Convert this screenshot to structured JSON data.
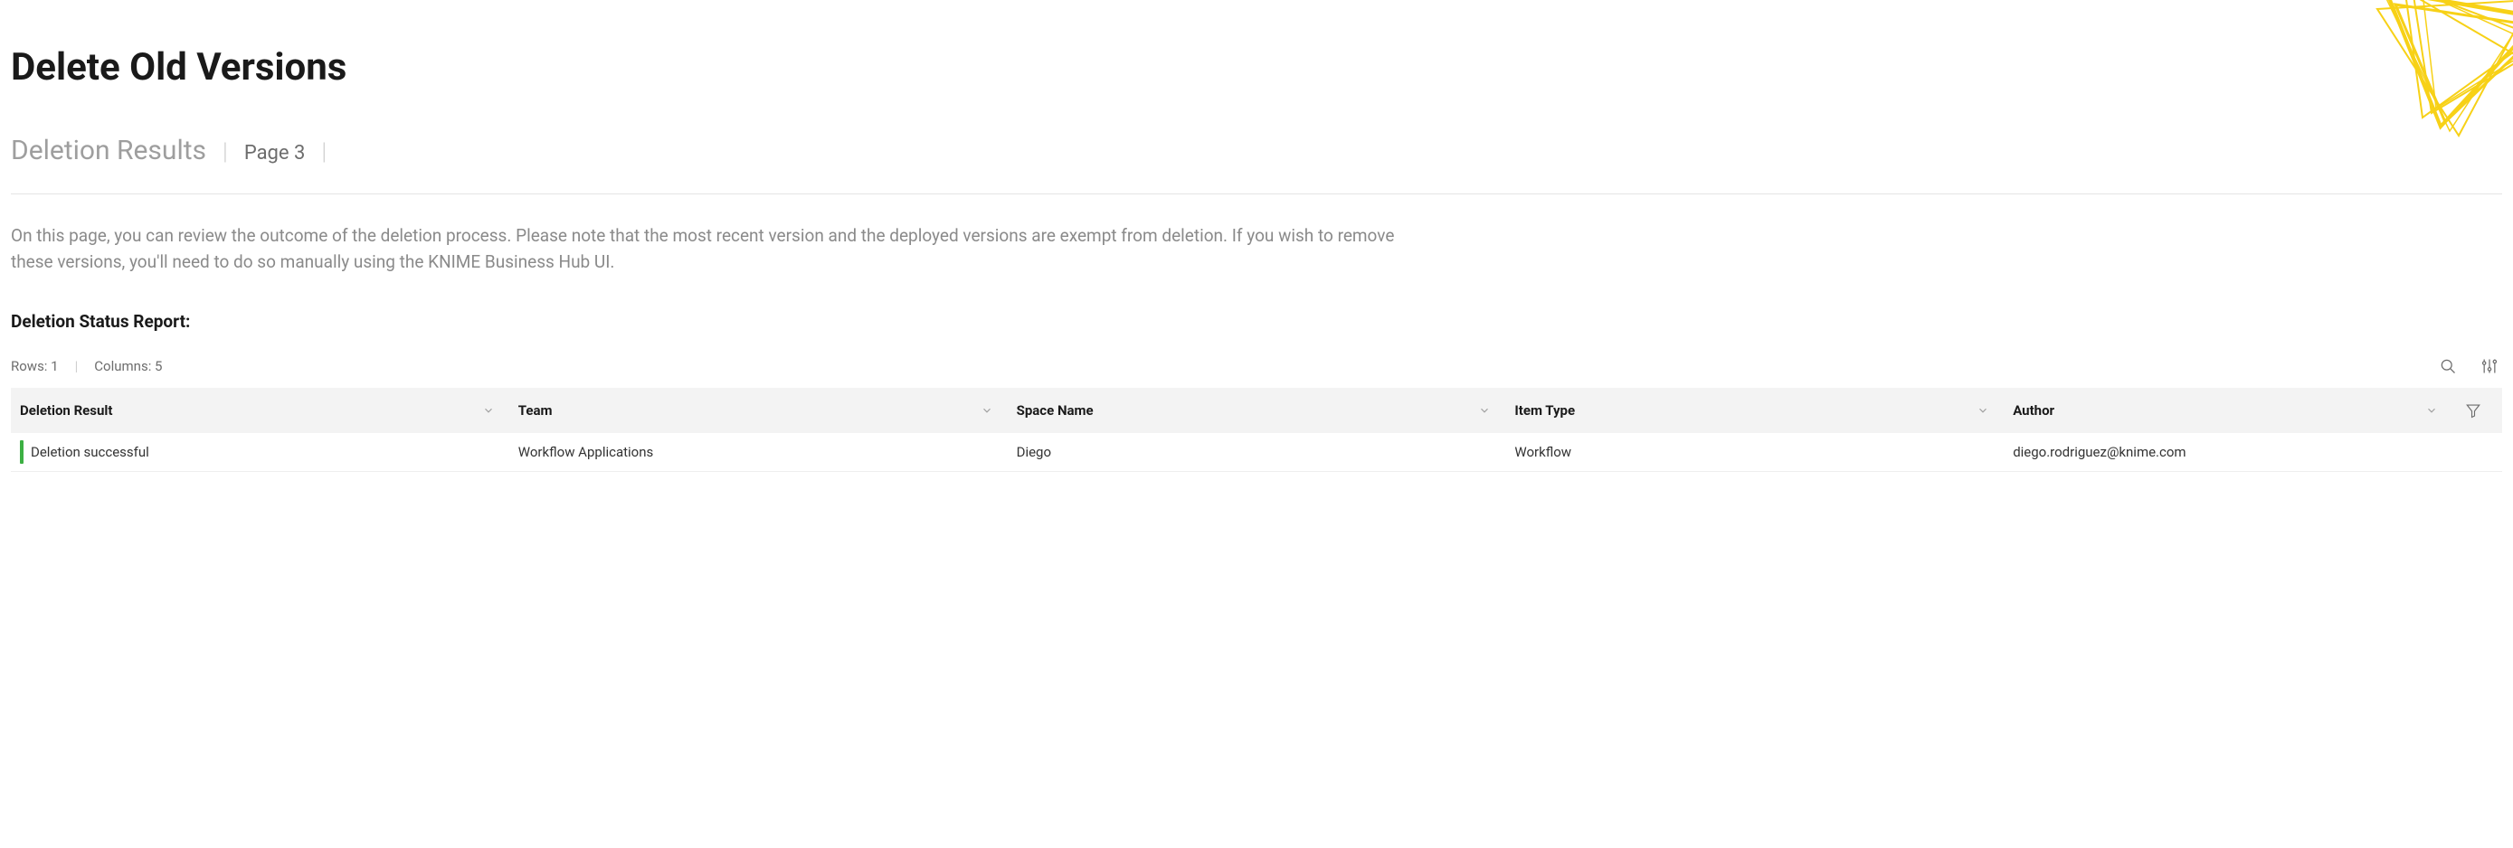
{
  "page": {
    "title": "Delete Old Versions",
    "breadcrumb": {
      "section": "Deletion Results",
      "page_label": "Page 3"
    },
    "description": "On this page, you can review the outcome of the deletion process. Please note that the most recent version and the deployed versions are exempt from deletion. If you wish to remove these versions, you'll need to do so manually using the KNIME Business Hub UI.",
    "report_title": "Deletion Status Report:"
  },
  "table": {
    "meta": {
      "rows_label": "Rows: 1",
      "columns_label": "Columns: 5"
    },
    "columns": [
      {
        "label": "Deletion Result"
      },
      {
        "label": "Team"
      },
      {
        "label": "Space Name"
      },
      {
        "label": "Item Type"
      },
      {
        "label": "Author"
      }
    ],
    "rows": [
      {
        "deletion_result": "Deletion successful",
        "team": "Workflow Applications",
        "space_name": "Diego",
        "item_type": "Workflow",
        "author": "diego.rodriguez@knime.com"
      }
    ]
  }
}
